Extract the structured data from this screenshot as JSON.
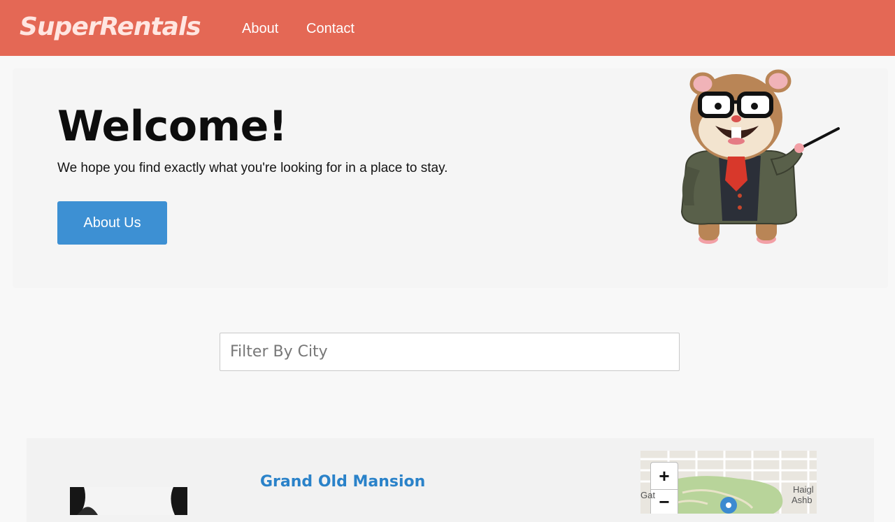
{
  "header": {
    "brand": "SuperRentals",
    "nav": [
      {
        "label": "About"
      },
      {
        "label": "Contact"
      }
    ],
    "colors": {
      "bar": "#e46855",
      "brand_text": "#ffe6e1"
    }
  },
  "jumbotron": {
    "title": "Welcome!",
    "tagline": "We hope you find exactly what you're looking for in a place to stay.",
    "button_label": "About Us",
    "mascot_icon": "tomster-mascot-icon"
  },
  "filter": {
    "placeholder": "Filter By City",
    "value": ""
  },
  "listing": {
    "title": "Grand Old Mansion",
    "map": {
      "zoom_in": "+",
      "zoom_out": "−",
      "labels": [
        "Haigl",
        "Ashb",
        "Gat"
      ]
    }
  }
}
